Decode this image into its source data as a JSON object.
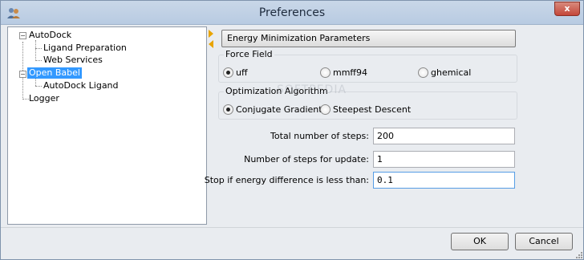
{
  "window": {
    "title": "Preferences",
    "close_label": "x"
  },
  "tree": {
    "nodes": [
      {
        "label": "AutoDock"
      },
      {
        "label": "Ligand Preparation"
      },
      {
        "label": "Web Services"
      },
      {
        "label": "Open Babel",
        "selected": true
      },
      {
        "label": "AutoDock Ligand"
      },
      {
        "label": "Logger"
      }
    ]
  },
  "panel": {
    "section_title": "Energy Minimization Parameters",
    "force_field": {
      "title": "Force Field",
      "options": [
        "uff",
        "mmff94",
        "ghemical"
      ],
      "selected": "uff"
    },
    "optimization": {
      "title": "Optimization Algorithm",
      "options": [
        "Conjugate Gradients",
        "Steepest Descent"
      ],
      "selected": "Conjugate Gradients"
    },
    "fields": [
      {
        "label": "Total number of steps:",
        "value": "200"
      },
      {
        "label": "Number of steps for update:",
        "value": "1"
      },
      {
        "label": "Stop if energy difference is less than:",
        "value": "0.1"
      }
    ]
  },
  "watermark": "SOFTPEDIA",
  "buttons": {
    "ok": "OK",
    "cancel": "Cancel"
  }
}
